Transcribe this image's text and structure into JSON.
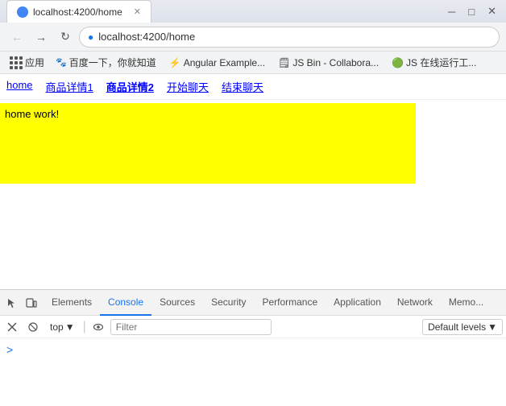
{
  "browser": {
    "address": "localhost:4200/home",
    "tab_title": "localhost:4200/home"
  },
  "bookmarks": {
    "apps_label": "应用",
    "items": [
      {
        "id": "baidu",
        "label": "百度一下，你就知道",
        "icon": "🐾"
      },
      {
        "id": "angular",
        "label": "Angular Example...",
        "icon": "⚡"
      },
      {
        "id": "jsbin",
        "label": "JS Bin - Collabora...",
        "icon": "🗒"
      },
      {
        "id": "jsonline",
        "label": "JS 在线运行工...",
        "icon": "🟢"
      }
    ]
  },
  "page": {
    "nav_links": [
      "home",
      "商品详情1",
      "商品详情2",
      "开始聊天",
      "结束聊天"
    ],
    "content_text": "home work!"
  },
  "devtools": {
    "tabs": [
      {
        "id": "elements",
        "label": "Elements",
        "active": false
      },
      {
        "id": "console",
        "label": "Console",
        "active": true
      },
      {
        "id": "sources",
        "label": "Sources",
        "active": false
      },
      {
        "id": "security",
        "label": "Security",
        "active": false
      },
      {
        "id": "performance",
        "label": "Performance",
        "active": false
      },
      {
        "id": "application",
        "label": "Application",
        "active": false
      },
      {
        "id": "network",
        "label": "Network",
        "active": false
      },
      {
        "id": "memory",
        "label": "Memo...",
        "active": false
      }
    ],
    "toolbar": {
      "context_label": "top",
      "filter_placeholder": "Filter",
      "levels_label": "Default levels"
    }
  }
}
